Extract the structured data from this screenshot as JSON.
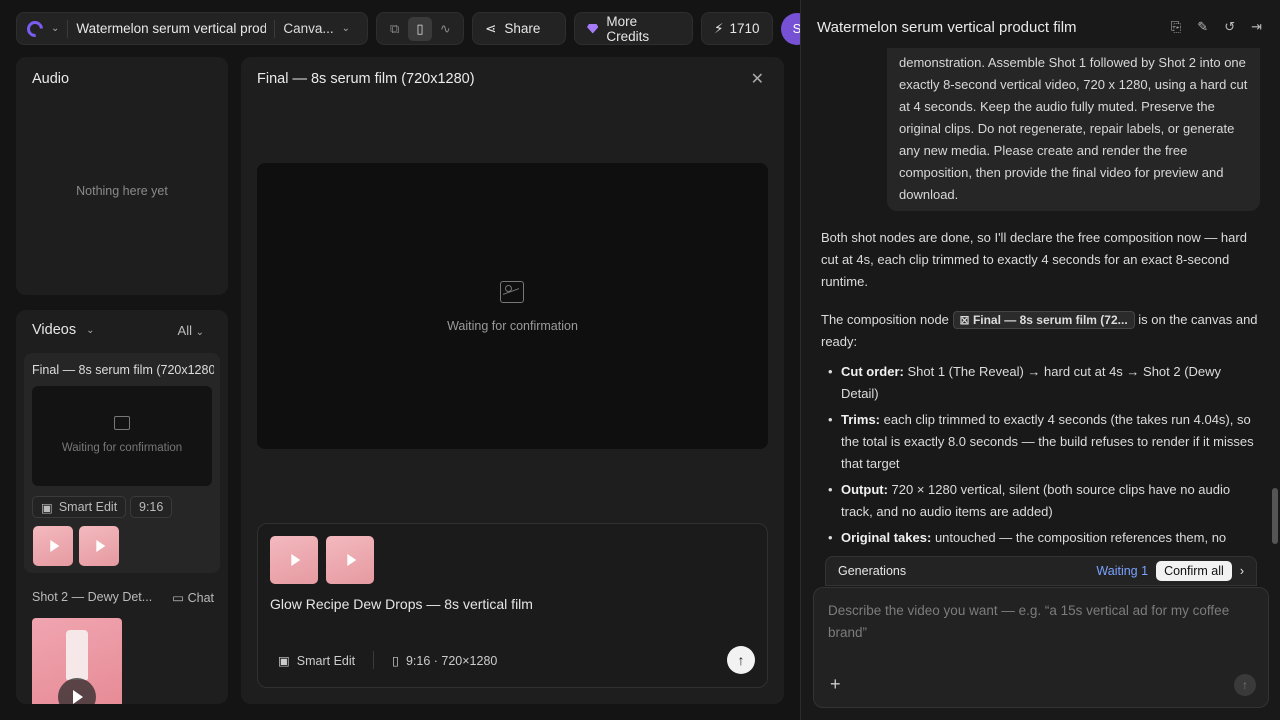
{
  "topbar": {
    "project_title": "Watermelon serum vertical product film",
    "canvas_label": "Canva...",
    "share_label": "Share",
    "credits_label": "More Credits",
    "balance": "1710",
    "avatar_initial": "S"
  },
  "audio": {
    "title": "Audio",
    "empty": "Nothing here yet"
  },
  "videos": {
    "title": "Videos",
    "filter": "All",
    "card": {
      "title": "Final — 8s serum film (720x1280)",
      "waiting": "Waiting for confirmation",
      "smart_edit": "Smart Edit",
      "ratio": "9:16"
    },
    "shot2": {
      "title": "Shot 2 — Dewy Det...",
      "chat": "Chat"
    }
  },
  "center": {
    "title": "Final — 8s serum film (720x1280)",
    "waiting": "Waiting for confirmation",
    "composer_title": "Glow Recipe Dew Drops — 8s vertical film",
    "smart_edit": "Smart Edit",
    "format": "9:16 · 720×1280"
  },
  "chat": {
    "header": "Watermelon serum vertical product film",
    "user_msg": "demonstration. Assemble Shot 1 followed by Shot 2 into one exactly 8-second vertical video, 720 x 1280, using a hard cut at 4 seconds. Keep the audio fully muted. Preserve the original clips. Do not regenerate, repair labels, or generate any new media. Please create and render the free composition, then provide the final video for preview and download.",
    "p1": "Both shot nodes are done, so I'll declare the free composition now — hard cut at 4s, each clip trimmed to exactly 4 seconds for an exact 8-second runtime.",
    "p2_before": "The composition node",
    "p2_chip": "Final — 8s serum film (72...",
    "p2_after": "is on the canvas and ready:",
    "bullets": [
      {
        "label": "Cut order:",
        "text": "Shot 1 (The Reveal) → hard cut at 4s → Shot 2 (Dewy Detail)"
      },
      {
        "label": "Trims:",
        "text": "each clip trimmed to exactly 4 seconds (the takes run 4.04s), so the total is exactly 8.0 seconds — the build refuses to render if it misses that target"
      },
      {
        "label": "Output:",
        "text": "720 × 1280 vertical, silent (both source clips have no audio track, and no audio items are added)"
      },
      {
        "label": "Original takes:",
        "text": "untouched — the composition references them, no"
      }
    ],
    "generations_label": "Generations",
    "waiting_count": "Waiting 1",
    "confirm_all": "Confirm all",
    "input_placeholder": "Describe the video you want — e.g. “a 15s vertical ad for my coffee brand”"
  }
}
